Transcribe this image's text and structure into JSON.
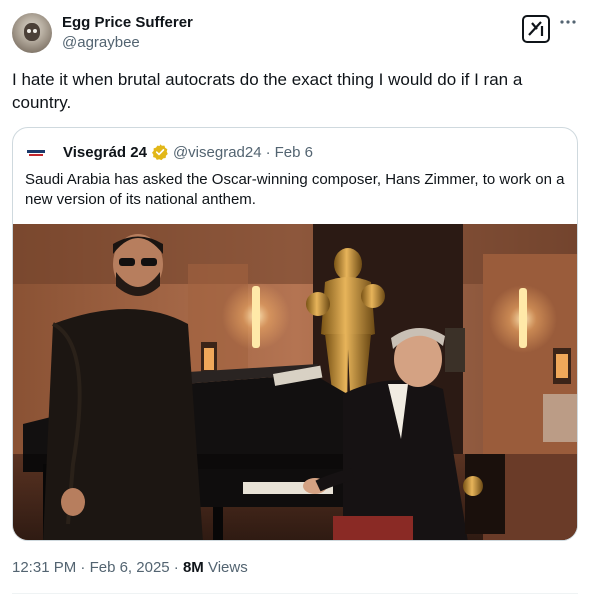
{
  "author": {
    "display_name": "Egg Price Sufferer",
    "handle": "@agraybee"
  },
  "icons": {
    "avatar": "cat-photo-avatar",
    "grok": "grok-icon",
    "more": "more-dots-icon",
    "verified": "gold-verified-badge-icon"
  },
  "tweet": {
    "text": "I hate it when brutal autocrats do the exact thing I would do if I ran a country."
  },
  "quote": {
    "display_name": "Visegrád 24",
    "handle": "@visegrad24",
    "separator": "·",
    "date": "Feb 6",
    "text": "Saudi Arabia has asked the Oscar-winning composer, Hans Zimmer, to work on a new version of its national anthem."
  },
  "footer": {
    "time": "12:31 PM",
    "sep1": "·",
    "date": "Feb 6, 2025",
    "sep2": "·",
    "views_count": "8M",
    "views_label": "Views"
  },
  "colors": {
    "text_primary": "#0f1419",
    "text_secondary": "#536471",
    "border": "#cfd9de",
    "verified_gold": "#e2b719"
  }
}
